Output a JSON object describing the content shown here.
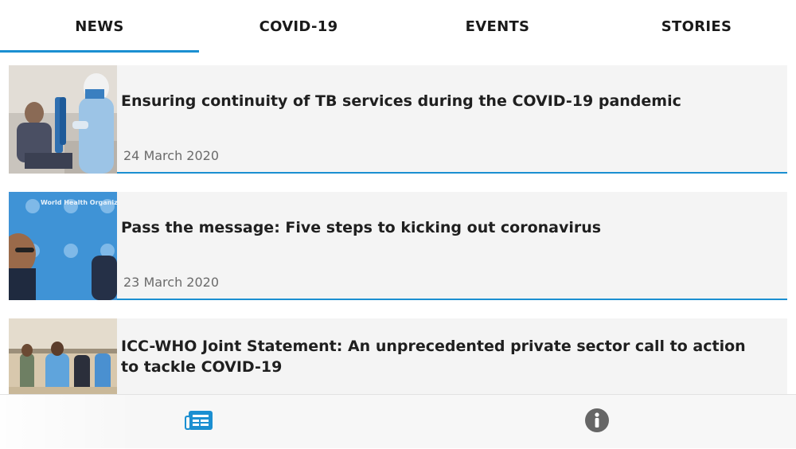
{
  "tabs": [
    {
      "label": "NEWS",
      "active": true
    },
    {
      "label": "COVID-19",
      "active": false
    },
    {
      "label": "EVENTS",
      "active": false
    },
    {
      "label": "STORIES",
      "active": false
    }
  ],
  "news": [
    {
      "title": "Ensuring continuity of TB services during the COVID-19 pandemic",
      "date": "24 March 2020"
    },
    {
      "title": "Pass the message: Five steps to kicking out coronavirus",
      "date": "23 March 2020"
    },
    {
      "title": "ICC-WHO Joint Statement: An unprecedented private sector call to action to tackle COVID-19",
      "date": ""
    }
  ],
  "thumb_watermark": "World Health Organization",
  "bottom_nav": [
    {
      "icon": "news-list-icon",
      "active": true
    },
    {
      "icon": "info-icon",
      "active": false
    }
  ],
  "colors": {
    "accent": "#1b8fd1",
    "card_bg": "#f4f4f4",
    "inactive_icon": "#666666"
  }
}
